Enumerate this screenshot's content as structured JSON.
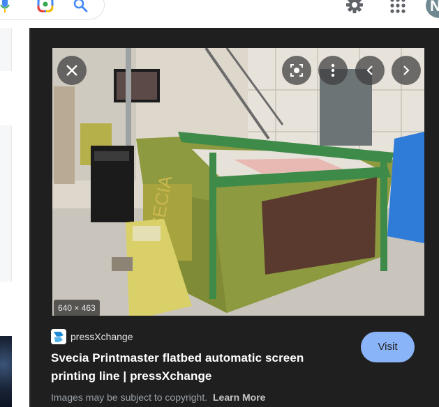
{
  "top_bar": {
    "avatar_letter": "N",
    "icons": [
      "mic-icon",
      "lens-icon",
      "search-icon",
      "gear-icon",
      "apps-icon"
    ]
  },
  "preview": {
    "image_dimensions": "640 × 463",
    "source": "pressXchange",
    "title": "Svecia Printmaster flatbed automatic screen printing line | pressXchange",
    "visit_label": "Visit",
    "copyright_text": "Images may be subject to copyright.",
    "learn_more_label": "Learn More",
    "controls": [
      "close-icon",
      "lens-search-icon",
      "more-vert-icon",
      "chevron-left-icon",
      "chevron-right-icon"
    ]
  },
  "colors": {
    "panel_bg": "#1f1f1f",
    "visit_button": "#8ab4f8",
    "machine_green": "#8c9a3c",
    "frame_green": "#3f8a4a"
  }
}
